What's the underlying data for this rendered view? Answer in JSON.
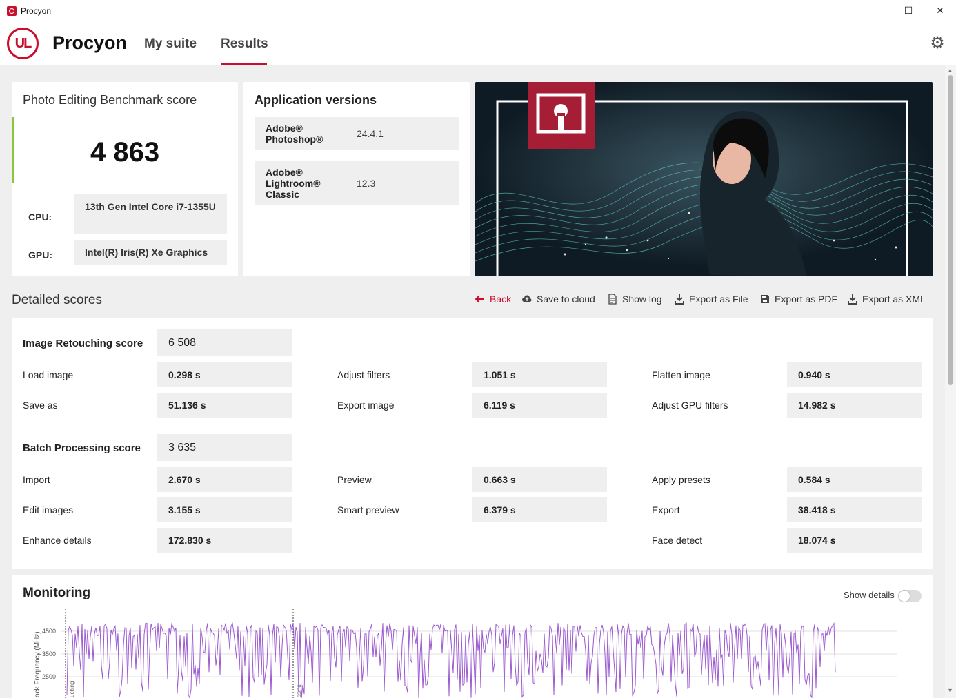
{
  "window": {
    "title": "Procyon",
    "minimize": "—",
    "maximize": "☐",
    "close": "✕"
  },
  "header": {
    "logo_text": "UL",
    "brand": "Procyon",
    "nav": [
      {
        "label": "My suite",
        "active": false
      },
      {
        "label": "Results",
        "active": true
      }
    ],
    "settings_icon": "gear-icon"
  },
  "score_card": {
    "title": "Photo Editing Benchmark score",
    "score": "4 863",
    "accent_color": "#8cc63f",
    "cpu_label": "CPU:",
    "cpu_value": "13th Gen Intel Core i7-1355U",
    "gpu_label": "GPU:",
    "gpu_value": "Intel(R) Iris(R) Xe Graphics"
  },
  "app_versions": {
    "title": "Application versions",
    "apps": [
      {
        "name": "Adobe® Photoshop®",
        "version": "24.4.1"
      },
      {
        "name": "Adobe® Lightroom® Classic",
        "version": "12.3"
      }
    ]
  },
  "detailed": {
    "title": "Detailed scores",
    "actions": [
      {
        "label": "Back",
        "icon": "arrow-left-icon"
      },
      {
        "label": "Save to cloud",
        "icon": "cloud-upload-icon"
      },
      {
        "label": "Show log",
        "icon": "document-icon"
      },
      {
        "label": "Export as File",
        "icon": "download-icon"
      },
      {
        "label": "Export as PDF",
        "icon": "floppy-icon"
      },
      {
        "label": "Export as XML",
        "icon": "download-icon"
      }
    ],
    "retouching": {
      "label": "Image Retouching score",
      "score": "6 508",
      "items": [
        {
          "label": "Load image",
          "value": "0.298 s"
        },
        {
          "label": "Adjust filters",
          "value": "1.051 s"
        },
        {
          "label": "Flatten image",
          "value": "0.940 s"
        },
        {
          "label": "Save as",
          "value": "51.136 s"
        },
        {
          "label": "Export image",
          "value": "6.119 s"
        },
        {
          "label": "Adjust GPU filters",
          "value": "14.982 s"
        }
      ]
    },
    "batch": {
      "label": "Batch Processing score",
      "score": "3 635",
      "items": [
        {
          "label": "Import",
          "value": "2.670 s"
        },
        {
          "label": "Preview",
          "value": "0.663 s"
        },
        {
          "label": "Apply presets",
          "value": "0.584 s"
        },
        {
          "label": "Edit images",
          "value": "3.155 s"
        },
        {
          "label": "Smart preview",
          "value": "6.379 s"
        },
        {
          "label": "Export",
          "value": "38.418 s"
        },
        {
          "label": "Enhance details",
          "value": "172.830 s"
        },
        {
          "label": "Face detect",
          "value": "18.074 s"
        }
      ]
    }
  },
  "monitoring": {
    "title": "Monitoring",
    "show_details_label": "Show details",
    "show_details_on": false,
    "axis_label": "ock Frequency (MHz)",
    "ticks": [
      "4500",
      "3500",
      "2500"
    ],
    "marker_labels": [
      "uching",
      "ssing"
    ],
    "line_color": "#9b59d0"
  }
}
